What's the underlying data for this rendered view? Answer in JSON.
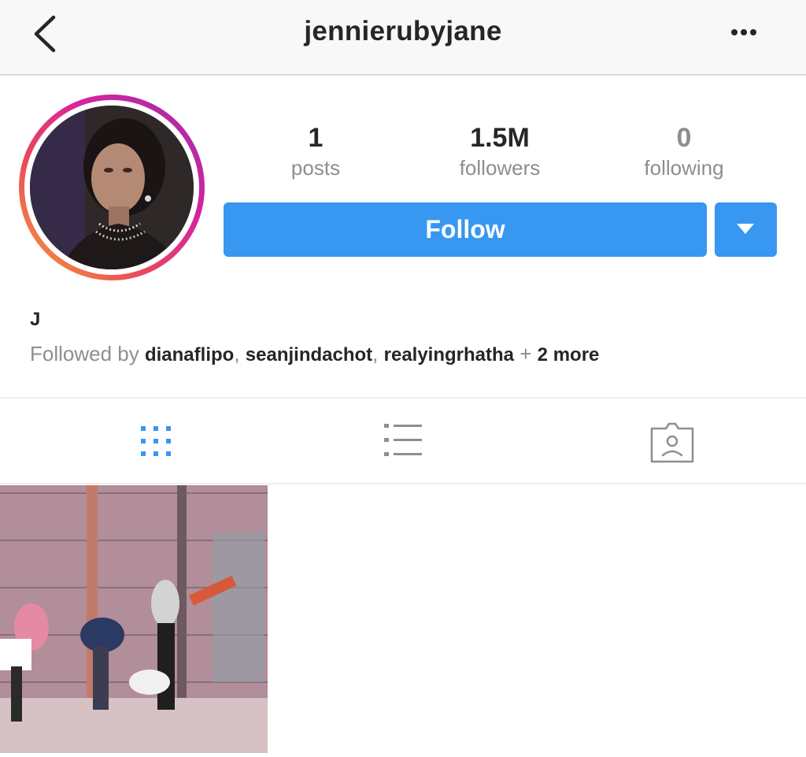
{
  "header": {
    "title": "jennierubyjane",
    "back_icon": "chevron-left-icon",
    "more_icon": "ellipsis-icon"
  },
  "profile": {
    "stats": [
      {
        "value": "1",
        "label": "posts"
      },
      {
        "value": "1.5M",
        "label": "followers"
      },
      {
        "value": "0",
        "label": "following"
      }
    ],
    "follow_label": "Follow",
    "dropdown_icon": "caret-down-icon",
    "name": "J",
    "followed_by": {
      "prefix": "Followed by",
      "users": [
        "dianaflipo",
        "seanjindachot",
        "realyingrhatha"
      ],
      "separator": ",",
      "plus": "+",
      "more": "2 more"
    }
  },
  "tabs": [
    {
      "id": "grid",
      "icon": "grid-icon",
      "active": true
    },
    {
      "id": "list",
      "icon": "list-icon",
      "active": false
    },
    {
      "id": "tagged",
      "icon": "tagged-icon",
      "active": false
    }
  ],
  "colors": {
    "accent": "#3897f0",
    "text": "#262626",
    "muted": "#8e8e8e",
    "ring_start": "#9b2ea9",
    "ring_end": "#f9a23a"
  }
}
